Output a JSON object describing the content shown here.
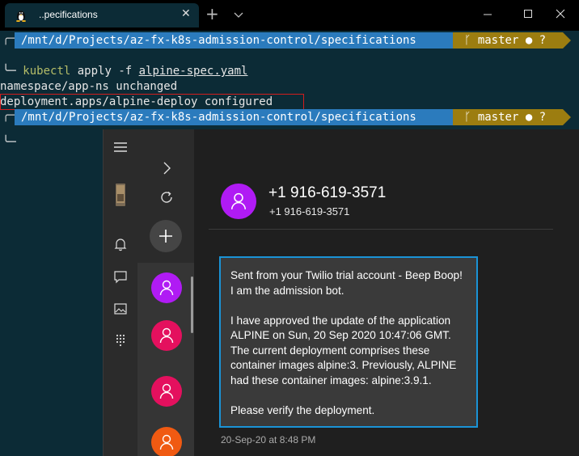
{
  "terminal": {
    "tab_title": "..pecifications",
    "tab_close": "✕",
    "new_tab": "+",
    "prompt_corner_top": "╭─",
    "prompt_corner_bottom": "╰─",
    "prompt_path": "/mnt/d/Projects/az-fx-k8s-admission-control/specifications",
    "git_branch": "ᚴ master ● ?",
    "command": "kubectl",
    "command_args_prefix": " apply -f ",
    "command_file": "alpine-spec.yaml",
    "output_lines": [
      "namespace/app-ns unchanged",
      "deployment.apps/alpine-deploy configured"
    ]
  },
  "phone_app": {
    "contact_name": "+1 916-619-3571",
    "contact_number": "+1 916-619-3571",
    "message_paragraphs": [
      "Sent from your Twilio trial account - Beep Boop! I am the admission bot.",
      "I have approved the update of the application ALPINE on Sun, 20 Sep 2020 10:47:06 GMT. The current deployment comprises these container images alpine:3. Previously, ALPINE had these container images: alpine:3.9.1.",
      "Please verify the deployment."
    ],
    "message_time": "20-Sep-20 at 8:48 PM",
    "thread_avatar_colors": [
      "#b01bf4",
      "#e4105e",
      "#e4105e",
      "#e4105e",
      "#f05a12"
    ],
    "icons": [
      "hamburger-icon",
      "phone-thumbnail-icon",
      "bell-icon",
      "chat-icon",
      "photo-icon",
      "dialpad-icon",
      "chevron-right-icon",
      "refresh-icon",
      "add-icon",
      "person-icon"
    ]
  }
}
